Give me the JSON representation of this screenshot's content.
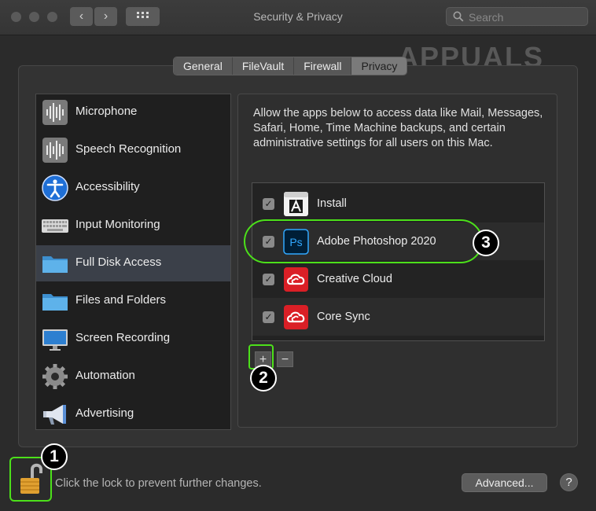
{
  "window": {
    "title": "Security & Privacy",
    "back_glyph": "‹",
    "forward_glyph": "›"
  },
  "search": {
    "placeholder": "Search"
  },
  "watermark": "APPUALS",
  "tabs": [
    {
      "label": "General",
      "active": false
    },
    {
      "label": "FileVault",
      "active": false
    },
    {
      "label": "Firewall",
      "active": false
    },
    {
      "label": "Privacy",
      "active": true
    }
  ],
  "sidebar": {
    "items": [
      {
        "label": "Microphone",
        "icon": "microphone-icon"
      },
      {
        "label": "Speech Recognition",
        "icon": "speech-recognition-icon"
      },
      {
        "label": "Accessibility",
        "icon": "accessibility-icon"
      },
      {
        "label": "Input Monitoring",
        "icon": "keyboard-icon"
      },
      {
        "label": "Full Disk Access",
        "icon": "folder-icon",
        "selected": true
      },
      {
        "label": "Files and Folders",
        "icon": "folder-icon"
      },
      {
        "label": "Screen Recording",
        "icon": "display-icon"
      },
      {
        "label": "Automation",
        "icon": "gear-icon"
      },
      {
        "label": "Advertising",
        "icon": "megaphone-icon"
      }
    ]
  },
  "content": {
    "description": "Allow the apps below to access data like Mail, Messages, Safari, Home, Time Machine backups, and certain administrative settings for all users on this Mac.",
    "apps": [
      {
        "label": "Install",
        "checked": true,
        "icon": "adobe-installer-icon",
        "check_glyph": "✓"
      },
      {
        "label": "Adobe Photoshop 2020",
        "checked": true,
        "icon": "photoshop-icon",
        "icon_text": "Ps",
        "check_glyph": "✓"
      },
      {
        "label": "Creative Cloud",
        "checked": true,
        "icon": "creative-cloud-icon",
        "check_glyph": "✓"
      },
      {
        "label": "Core Sync",
        "checked": true,
        "icon": "core-sync-icon",
        "check_glyph": "✓"
      }
    ],
    "add_label": "+",
    "remove_label": "−"
  },
  "footer": {
    "lock_text": "Click the lock to prevent further changes.",
    "advanced_label": "Advanced...",
    "help_label": "?"
  },
  "annotations": [
    "1",
    "2",
    "3"
  ],
  "colors": {
    "highlight": "#4ce01a",
    "selection": "#3b4049",
    "adobe_red": "#da1f26",
    "photoshop_bg": "#001e36",
    "photoshop_fg": "#31a8ff",
    "lock_gold": "#e0a030"
  }
}
